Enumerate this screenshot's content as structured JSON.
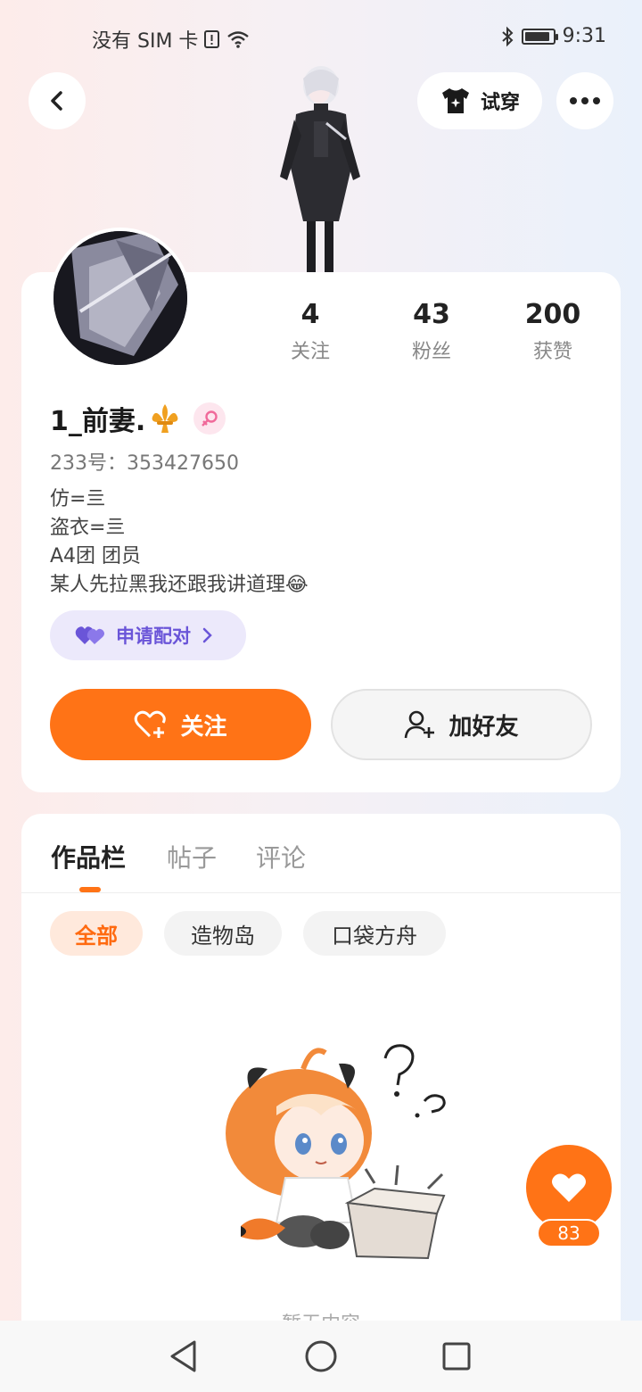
{
  "status_bar": {
    "carrier": "没有 SIM 卡",
    "time": "9:31",
    "battery_level": 0.9
  },
  "header": {
    "try_on_label": "试穿"
  },
  "profile": {
    "stats": [
      {
        "value": "4",
        "label": "关注"
      },
      {
        "value": "43",
        "label": "粉丝"
      },
      {
        "value": "200",
        "label": "获赞"
      }
    ],
    "username": "1_前妻.",
    "uid": "233号：353427650",
    "bio": [
      "仿=亖",
      "盗衣=亖",
      "A4团 团员",
      "某人先拉黑我还跟我讲道理😂"
    ],
    "pair_label": "申请配对",
    "follow_label": "关注",
    "add_friend_label": "加好友"
  },
  "works": {
    "tabs": [
      "作品栏",
      "帖子",
      "评论"
    ],
    "active_tab": 0,
    "filters": [
      "全部",
      "造物岛",
      "口袋方舟"
    ],
    "active_filter": 0,
    "empty_text": "暂无内容"
  },
  "like_fab": {
    "count": "83"
  },
  "colors": {
    "accent": "#ff7316",
    "pair": "#6a55d8"
  }
}
